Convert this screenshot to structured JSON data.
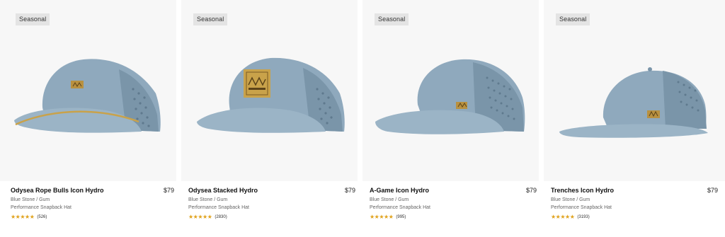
{
  "products": [
    {
      "badge": "Seasonal",
      "name": "Odysea Rope Bulls Icon Hydro",
      "price": "$79",
      "variant": "Blue Stone / Gum",
      "type": "Performance Snapback Hat",
      "stars": "★★★★★",
      "reviews": "(526)",
      "image": "blue-curved-brim-hat-with-gold-rope-and-logo-patch"
    },
    {
      "badge": "Seasonal",
      "name": "Odysea Stacked Hydro",
      "price": "$79",
      "variant": "Blue Stone / Gum",
      "type": "Performance Snapback Hat",
      "stars": "★★★★★",
      "reviews": "(2830)",
      "image": "blue-curved-brim-hat-with-large-gold-square-patch"
    },
    {
      "badge": "Seasonal",
      "name": "A-Game Icon Hydro",
      "price": "$79",
      "variant": "Blue Stone / Gum",
      "type": "Performance Snapback Hat",
      "stars": "★★★★★",
      "reviews": "(995)",
      "image": "blue-curved-brim-hat-with-perforated-side-panel"
    },
    {
      "badge": "Seasonal",
      "name": "Trenches Icon Hydro",
      "price": "$79",
      "variant": "Blue Stone / Gum",
      "type": "Performance Snapback Hat",
      "stars": "★★★★★",
      "reviews": "(3193)",
      "image": "blue-flat-brim-hat-with-small-gold-logo"
    }
  ],
  "colors": {
    "hat_blue": "#7f9bb0",
    "accent_gold": "#c9a24a",
    "star_gold": "#e0a21b"
  }
}
